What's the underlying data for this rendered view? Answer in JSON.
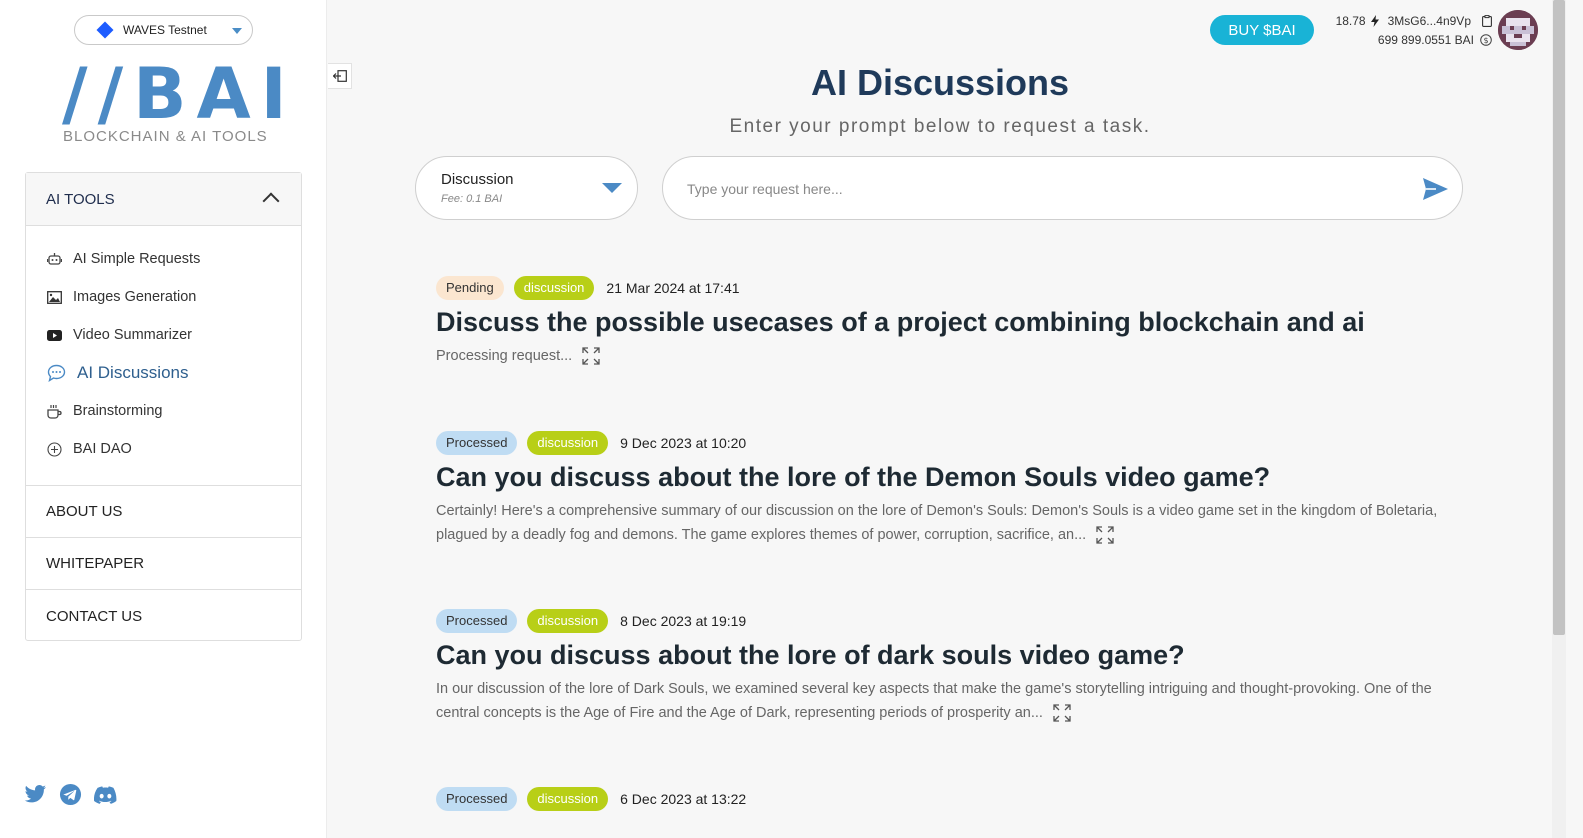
{
  "network": {
    "label": "WAVES Testnet"
  },
  "logo": {
    "mark": "//BAI",
    "subtitle": "BLOCKCHAIN & AI TOOLS"
  },
  "menu": {
    "header": "AI TOOLS",
    "tools": [
      {
        "label": "AI Simple Requests",
        "icon": "robot-icon"
      },
      {
        "label": "Images Generation",
        "icon": "image-icon"
      },
      {
        "label": "Video Summarizer",
        "icon": "youtube-icon"
      },
      {
        "label": "AI Discussions",
        "icon": "chat-icon"
      },
      {
        "label": "Brainstorming",
        "icon": "coffee-icon"
      },
      {
        "label": "BAI DAO",
        "icon": "plus-circle-icon"
      }
    ],
    "links": [
      "ABOUT US",
      "WHITEPAPER",
      "CONTACT US"
    ]
  },
  "header": {
    "buy_label": "BUY $BAI",
    "balance_waves": "18.78",
    "address": "3MsG6...4n9Vp",
    "balance_bai": "699 899.0551 BAI"
  },
  "page": {
    "title": "AI Discussions",
    "subtitle": "Enter your prompt below to request a task."
  },
  "task_select": {
    "value": "Discussion",
    "fee": "Fee: 0.1 BAI"
  },
  "prompt": {
    "placeholder": "Type your request here..."
  },
  "items": [
    {
      "status": "Pending",
      "type": "discussion",
      "date": "21 Mar 2024 at 17:41",
      "title": "Discuss the possible usecases of a project combining blockchain and ai",
      "summary": "Processing request..."
    },
    {
      "status": "Processed",
      "type": "discussion",
      "date": "9 Dec 2023 at 10:20",
      "title": "Can you discuss about the lore of the Demon Souls video game?",
      "summary": "Certainly! Here's a comprehensive summary of our discussion on the lore of Demon's Souls: Demon's Souls is a video game set in the kingdom of Boletaria, plagued by a deadly fog and demons. The game explores themes of power, corruption, sacrifice, an..."
    },
    {
      "status": "Processed",
      "type": "discussion",
      "date": "8 Dec 2023 at 19:19",
      "title": "Can you discuss about the lore of dark souls video game?",
      "summary": "In our discussion of the lore of Dark Souls, we examined several key aspects that make the game's storytelling intriguing and thought-provoking. One of the central concepts is the Age of Fire and the Age of Dark, representing periods of prosperity an..."
    },
    {
      "status": "Processed",
      "type": "discussion",
      "date": "6 Dec 2023 at 13:22",
      "title": "",
      "summary": ""
    }
  ]
}
